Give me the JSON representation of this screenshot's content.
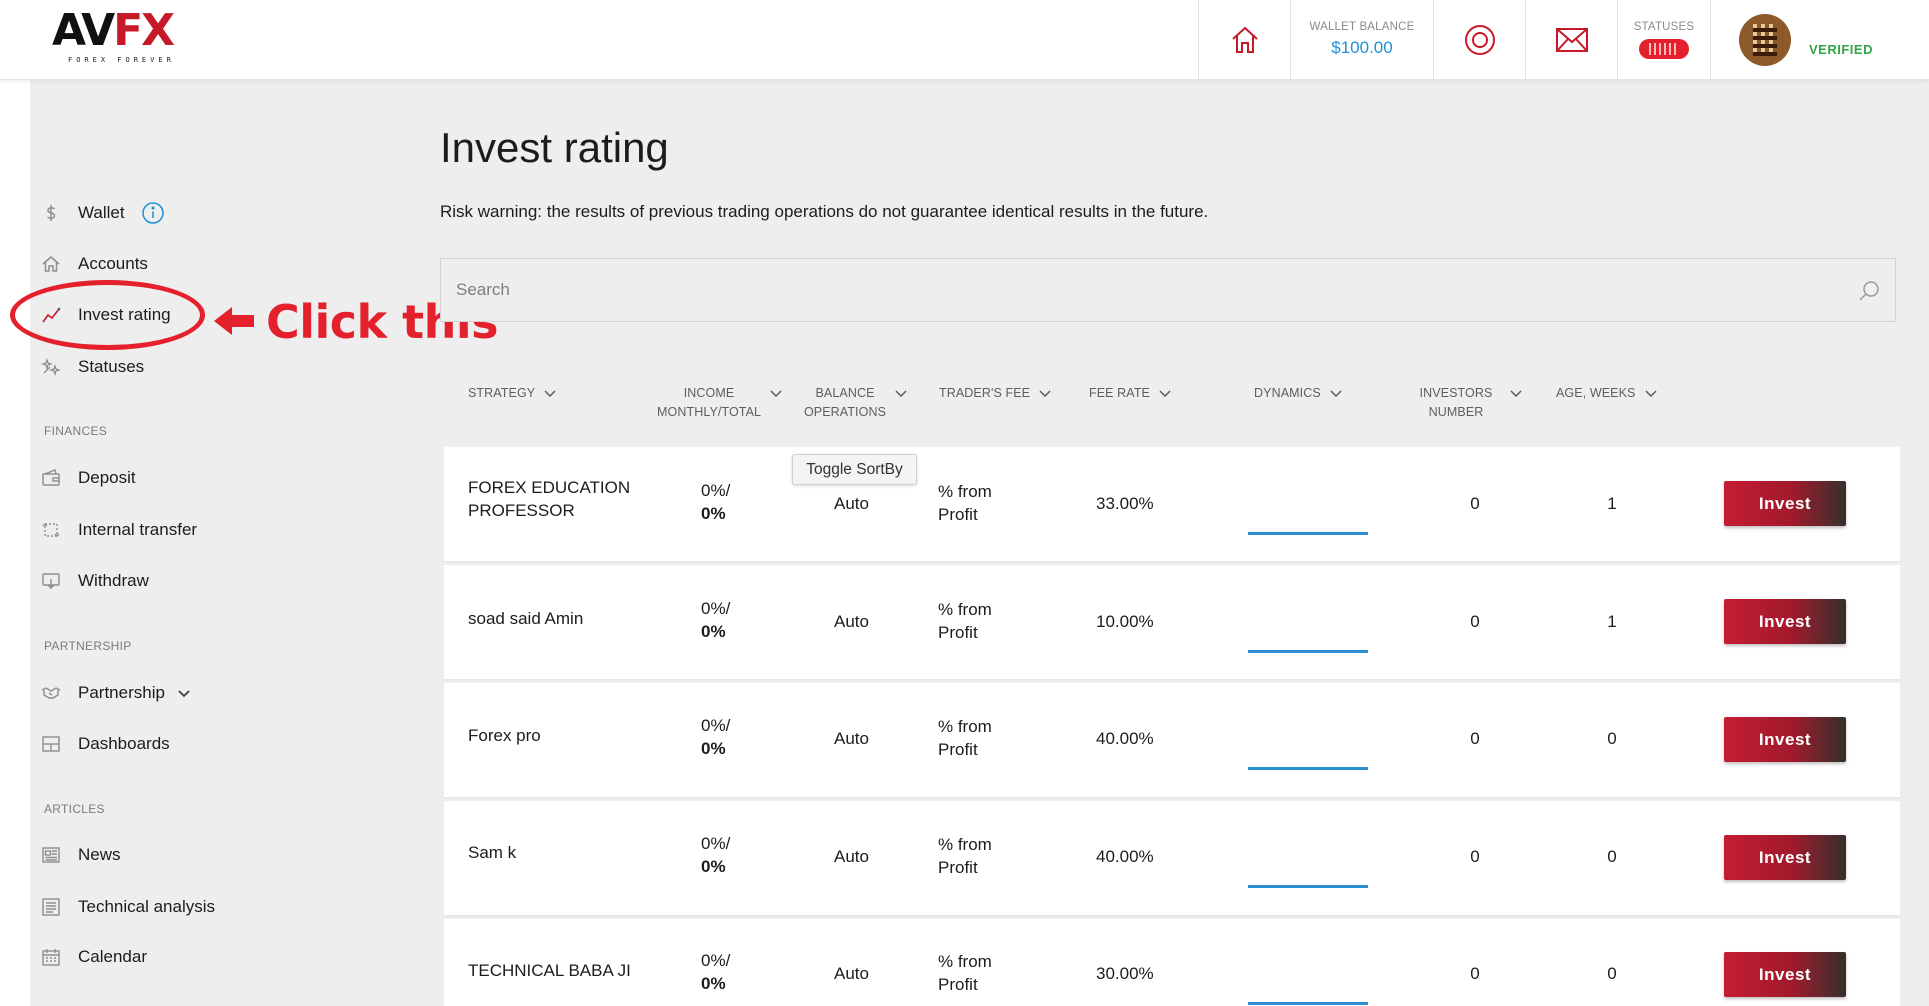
{
  "header": {
    "logo_text": "AVFX",
    "logo_tagline": "FOREX FOREVER",
    "wallet_label": "WALLET BALANCE",
    "wallet_value": "$100.00",
    "statuses_label": "STATUSES",
    "verified_label": "VERIFIED",
    "icons": [
      "home-icon",
      "target-icon",
      "mail-icon"
    ]
  },
  "sidebar": {
    "items": [
      {
        "label": "Wallet",
        "icon": "dollar-icon"
      },
      {
        "label": "Accounts",
        "icon": "home-icon"
      },
      {
        "label": "Invest rating",
        "icon": "chart-line-icon"
      },
      {
        "label": "Statuses",
        "icon": "stars-icon"
      }
    ],
    "finances_title": "FINANCES",
    "finances": [
      {
        "label": "Deposit",
        "icon": "wallet-icon"
      },
      {
        "label": "Internal transfer",
        "icon": "transfer-icon"
      },
      {
        "label": "Withdraw",
        "icon": "withdraw-icon"
      }
    ],
    "partnership_title": "PARTNERSHIP",
    "partnership": [
      {
        "label": "Partnership",
        "icon": "handshake-icon"
      },
      {
        "label": "Dashboards",
        "icon": "dashboard-icon"
      }
    ],
    "articles_title": "ARTICLES",
    "articles": [
      {
        "label": "News",
        "icon": "news-icon"
      },
      {
        "label": "Technical analysis",
        "icon": "analysis-icon"
      },
      {
        "label": "Calendar",
        "icon": "calendar-icon"
      }
    ]
  },
  "annotation": {
    "text": "Click this",
    "color": "#e3202c"
  },
  "main": {
    "title": "Invest rating",
    "risk_warning": "Risk warning: the results of previous trading operations do not guarantee identical results in the future.",
    "search_placeholder": "Search",
    "tooltip": "Toggle SortBy",
    "columns": [
      {
        "line1": "STRATEGY",
        "line2": ""
      },
      {
        "line1": "INCOME",
        "line2": "MONTHLY/TOTAL"
      },
      {
        "line1": "BALANCE",
        "line2": "OPERATIONS"
      },
      {
        "line1": "TRADER'S FEE",
        "line2": ""
      },
      {
        "line1": "FEE RATE",
        "line2": ""
      },
      {
        "line1": "DYNAMICS",
        "line2": ""
      },
      {
        "line1": "INVESTORS",
        "line2": "NUMBER"
      },
      {
        "line1": "AGE, WEEKS",
        "line2": ""
      }
    ],
    "rows": [
      {
        "name": "FOREX EDUCATION PROFESSOR",
        "income_monthly": "0%/",
        "income_total": "0%",
        "balance": "Auto",
        "fee": "% from Profit",
        "rate": "33.00%",
        "investors": "0",
        "age": "1",
        "button": "Invest"
      },
      {
        "name": "soad said Amin",
        "income_monthly": "0%/",
        "income_total": "0%",
        "balance": "Auto",
        "fee": "% from Profit",
        "rate": "10.00%",
        "investors": "0",
        "age": "1",
        "button": "Invest"
      },
      {
        "name": "Forex pro",
        "income_monthly": "0%/",
        "income_total": "0%",
        "balance": "Auto",
        "fee": "% from Profit",
        "rate": "40.00%",
        "investors": "0",
        "age": "0",
        "button": "Invest"
      },
      {
        "name": "Sam k",
        "income_monthly": "0%/",
        "income_total": "0%",
        "balance": "Auto",
        "fee": "% from Profit",
        "rate": "40.00%",
        "investors": "0",
        "age": "0",
        "button": "Invest"
      },
      {
        "name": "TECHNICAL BABA JI",
        "income_monthly": "0%/",
        "income_total": "0%",
        "balance": "Auto",
        "fee": "% from Profit",
        "rate": "30.00%",
        "investors": "0",
        "age": "0",
        "button": "Invest"
      }
    ]
  },
  "colors": {
    "accent_red": "#c41c33",
    "link_blue": "#1e90d6",
    "verified_green": "#2da646",
    "panel_bg": "#eeeeee"
  }
}
